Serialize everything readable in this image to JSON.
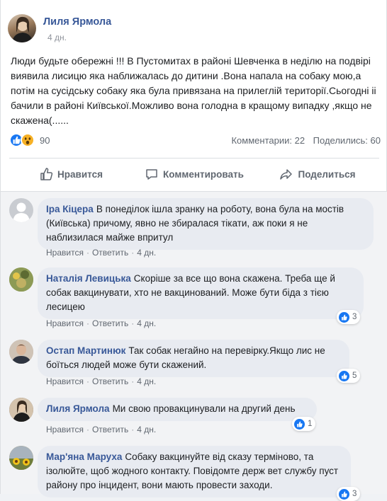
{
  "post": {
    "author": "Лиля Ярмола",
    "time": "4 дн.",
    "text": "Люди будьте обережні !!! В Пустомитах в районі Шевченка в неділю на подвірі виявила лисицю яка наближалась до дитини .Вона напала на собаку мою,а потім на сусідську собаку яка була привязана на прилеглій території.Сьогодні іі бачили в районі Київської.Можливо вона голодна в кращому випадку ,якщо не скажена(......",
    "reactions_count": "90",
    "comments_stat": "Комментарии: 22",
    "shares_stat": "Поделились: 60",
    "actions": {
      "like": "Нравится",
      "comment": "Комментировать",
      "share": "Поделиться"
    }
  },
  "comment_labels": {
    "like": "Нравится",
    "reply": "Ответить",
    "dot": "·"
  },
  "comments": [
    {
      "name": "Іра Кіцера",
      "text": "В понеділок ішла зранку на роботу, вона була на мостів (Київська) причому, явно не збиралася тікати, аж поки я не наблизилася майже впритул",
      "time": "4 дн."
    },
    {
      "name": "Наталія Левицька",
      "text": "Скоріше за все що вона скажена. Треба ще й собак вакцинувати, хто не вакцинований. Може бути біда з тією лесицею",
      "time": "4 дн.",
      "likes": "3"
    },
    {
      "name": "Остап Мартинюк",
      "text": "Так собак негайно на перевірку.Якщо лис не боїться людей може бути скажений.",
      "time": "4 дн.",
      "likes": "5"
    },
    {
      "name": "Лиля Ярмола",
      "text": "Ми свою провакцинували на другий день",
      "time": "4 дн.",
      "likes": "1"
    },
    {
      "name": "Мар'яна Маруха",
      "text": "Собаку вакцинуйте від сказу терміново, та ізолюйте, щоб жодного контакту. Повідомте держ вет службу пуст району про інцидент, вони мають провести заходи.",
      "likes": "3"
    }
  ],
  "colors": {
    "link": "#385898",
    "like_blue": "#1877f2",
    "wow_yellow": "#f7b125",
    "comment_bubble": "#e8ebf1"
  }
}
